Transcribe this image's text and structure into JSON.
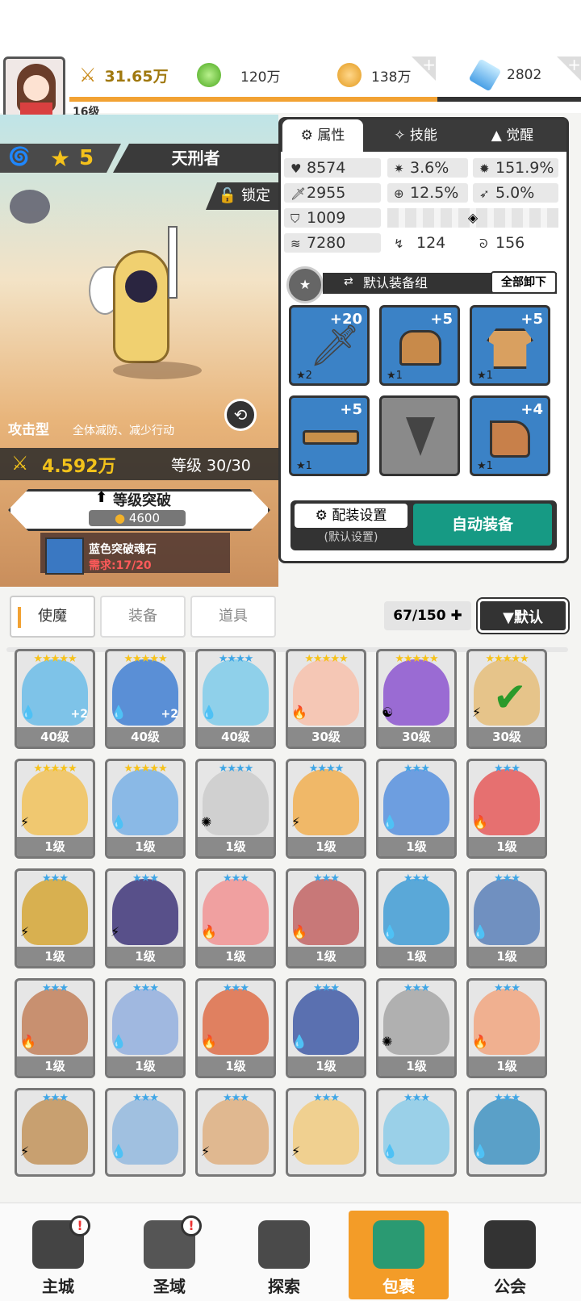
{
  "top": {
    "level": "16级",
    "power": "31.65万",
    "green": "120万",
    "gold": "138万",
    "gem": "2802",
    "xp_fraction": 0.72
  },
  "hero": {
    "stars": "5",
    "name": "天刑者",
    "lock": "锁定",
    "type": "攻击型",
    "type_desc": "全体减防、减少行动",
    "power": "4.592万",
    "level": "等级 30/30",
    "breakthrough": "等级突破",
    "cost": "4600",
    "stone_name": "蓝色突破魂石",
    "stone_req": "需求:17/20"
  },
  "tabs": [
    "属性",
    "技能",
    "觉醒"
  ],
  "stats": {
    "hp": "8574",
    "crit": "3.6%",
    "critdmg": "151.9%",
    "atk": "2955",
    "hit": "12.5%",
    "dodge": "5.0%",
    "def": "1009",
    "spd": "7280",
    "eff": "124",
    "res": "156"
  },
  "equip": {
    "group": "默认装备组",
    "unequip": "全部卸下",
    "slots": [
      {
        "lvl": "+20",
        "rank": "★2"
      },
      {
        "lvl": "+5",
        "rank": "★1"
      },
      {
        "lvl": "+5",
        "rank": "★1"
      },
      {
        "lvl": "+5",
        "rank": "★1"
      },
      {
        "lvl": "",
        "rank": ""
      },
      {
        "lvl": "+4",
        "rank": "★1"
      }
    ],
    "cfg": "配装设置",
    "cfg_sub": "(默认设置)",
    "auto": "自动装备"
  },
  "bag": {
    "tabs": [
      "使魔",
      "装备",
      "道具"
    ],
    "count": "67/150",
    "sort": "▼默认"
  },
  "cards": [
    {
      "stars": "★★★★★",
      "lvl": "40级",
      "plus": "+2",
      "elem": "💧",
      "color": "#7ec3e8"
    },
    {
      "stars": "★★★★★",
      "lvl": "40级",
      "plus": "+2",
      "elem": "💧",
      "color": "#5a8fd6"
    },
    {
      "stars": "★★★★",
      "lvl": "40级",
      "plus": "",
      "elem": "💧",
      "color": "#8fd0ea"
    },
    {
      "stars": "★★★★★",
      "lvl": "30级",
      "plus": "",
      "elem": "🔥",
      "color": "#f5c7b5"
    },
    {
      "stars": "★★★★★",
      "lvl": "30级",
      "plus": "",
      "elem": "☯",
      "color": "#9a6bd3"
    },
    {
      "stars": "★★★★★",
      "lvl": "30级",
      "plus": "",
      "elem": "⚡",
      "color": "#e6c48a",
      "check": "✔"
    },
    {
      "stars": "★★★★★",
      "lvl": "1级",
      "plus": "",
      "elem": "⚡",
      "color": "#f0c870"
    },
    {
      "stars": "★★★★★",
      "lvl": "1级",
      "plus": "",
      "elem": "💧",
      "color": "#8ab9e6"
    },
    {
      "stars": "★★★★",
      "lvl": "1级",
      "plus": "",
      "elem": "✺",
      "color": "#d0d0d0"
    },
    {
      "stars": "★★★★",
      "lvl": "1级",
      "plus": "",
      "elem": "⚡",
      "color": "#f0b868"
    },
    {
      "stars": "★★★",
      "lvl": "1级",
      "plus": "",
      "elem": "💧",
      "color": "#6d9ee0"
    },
    {
      "stars": "★★★",
      "lvl": "1级",
      "plus": "",
      "elem": "🔥",
      "color": "#e67070"
    },
    {
      "stars": "★★★",
      "lvl": "1级",
      "plus": "",
      "elem": "⚡",
      "color": "#d8b050"
    },
    {
      "stars": "★★★",
      "lvl": "1级",
      "plus": "",
      "elem": "⚡",
      "color": "#58508a"
    },
    {
      "stars": "★★★",
      "lvl": "1级",
      "plus": "",
      "elem": "🔥",
      "color": "#f0a0a0"
    },
    {
      "stars": "★★★",
      "lvl": "1级",
      "plus": "",
      "elem": "🔥",
      "color": "#c87878"
    },
    {
      "stars": "★★★",
      "lvl": "1级",
      "plus": "",
      "elem": "💧",
      "color": "#5aa8d8"
    },
    {
      "stars": "★★★",
      "lvl": "1级",
      "plus": "",
      "elem": "💧",
      "color": "#7090c0"
    },
    {
      "stars": "★★★",
      "lvl": "1级",
      "plus": "",
      "elem": "🔥",
      "color": "#c89070"
    },
    {
      "stars": "★★★",
      "lvl": "1级",
      "plus": "",
      "elem": "💧",
      "color": "#a0b8e0"
    },
    {
      "stars": "★★★",
      "lvl": "1级",
      "plus": "",
      "elem": "🔥",
      "color": "#e08060"
    },
    {
      "stars": "★★★",
      "lvl": "1级",
      "plus": "",
      "elem": "💧",
      "color": "#5a70b0"
    },
    {
      "stars": "★★★",
      "lvl": "1级",
      "plus": "",
      "elem": "✺",
      "color": "#b0b0b0"
    },
    {
      "stars": "★★★",
      "lvl": "1级",
      "plus": "",
      "elem": "🔥",
      "color": "#f0b090"
    },
    {
      "stars": "★★★",
      "lvl": "",
      "plus": "",
      "elem": "⚡",
      "color": "#c8a070"
    },
    {
      "stars": "★★★",
      "lvl": "",
      "plus": "",
      "elem": "💧",
      "color": "#a0c0e0"
    },
    {
      "stars": "★★★",
      "lvl": "",
      "plus": "",
      "elem": "⚡",
      "color": "#e0b890"
    },
    {
      "stars": "★★★",
      "lvl": "",
      "plus": "",
      "elem": "⚡",
      "color": "#f0d090"
    },
    {
      "stars": "★★★",
      "lvl": "",
      "plus": "",
      "elem": "💧",
      "color": "#9ad0e8"
    },
    {
      "stars": "★★★",
      "lvl": "",
      "plus": "",
      "elem": "💧",
      "color": "#5aa0c8"
    }
  ],
  "nav": [
    {
      "label": "主城",
      "badge": "!"
    },
    {
      "label": "圣域",
      "badge": "!"
    },
    {
      "label": "探索",
      "badge": ""
    },
    {
      "label": "包裹",
      "badge": ""
    },
    {
      "label": "公会",
      "badge": ""
    }
  ]
}
